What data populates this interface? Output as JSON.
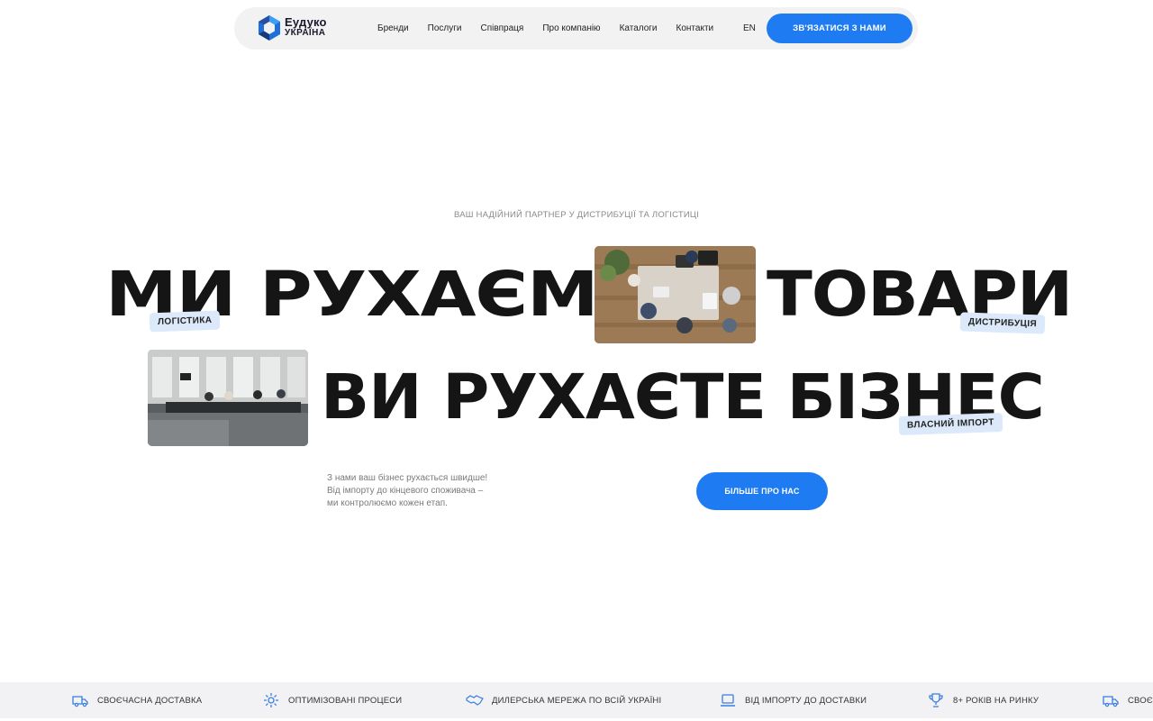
{
  "header": {
    "logo": {
      "line1": "Еудуко",
      "line2": "УКРАЇНА"
    },
    "nav": [
      "Бренди",
      "Послуги",
      "Співпраця",
      "Про компанію",
      "Каталоги",
      "Контакти"
    ],
    "lang": "EN",
    "cta": "ЗВ'ЯЗАТИСЯ З НАМИ"
  },
  "hero": {
    "tagline": "ВАШ НАДІЙНИЙ ПАРТНЕР У ДИСТРИБУЦІЇ ТА ЛОГІСТИЦІ",
    "line1_left": "МИ РУХАЄМО",
    "line1_right": "ТОВАРИ",
    "line2": "ВИ РУХАЄТЕ БІЗНЕС",
    "tags": [
      "ЛОГІСТИКА",
      "ДИСТРИБУЦІЯ",
      "ВЛАСНИЙ ІМПОРТ"
    ],
    "description": [
      "З нами ваш бізнес рухається швидше!",
      "Від імпорту до кінцевого споживача –",
      "ми контролюємо кожен етап."
    ],
    "cta": "БІЛЬШЕ ПРО НАС"
  },
  "ticker": {
    "items": [
      {
        "icon": "truck-icon",
        "label": "СВОЄЧАСНА ДОСТАВКА"
      },
      {
        "icon": "gear-icon",
        "label": "ОПТИМІЗОВАНІ ПРОЦЕСИ"
      },
      {
        "icon": "handshake-icon",
        "label": "ДИЛЕРСЬКА МЕРЕЖА ПО ВСІЙ УКРАЇНІ"
      },
      {
        "icon": "laptop-icon",
        "label": "ВІД ІМПОРТУ ДО ДОСТАВКИ"
      },
      {
        "icon": "trophy-icon",
        "label": "8+ РОКІВ НА РИНКУ"
      },
      {
        "icon": "truck-icon",
        "label": "СВОЄЧАСНА ДОСТАВКА"
      }
    ]
  },
  "colors": {
    "accent": "#1e7bf2",
    "tag_bg": "#dbe9fb",
    "text": "#151515"
  }
}
